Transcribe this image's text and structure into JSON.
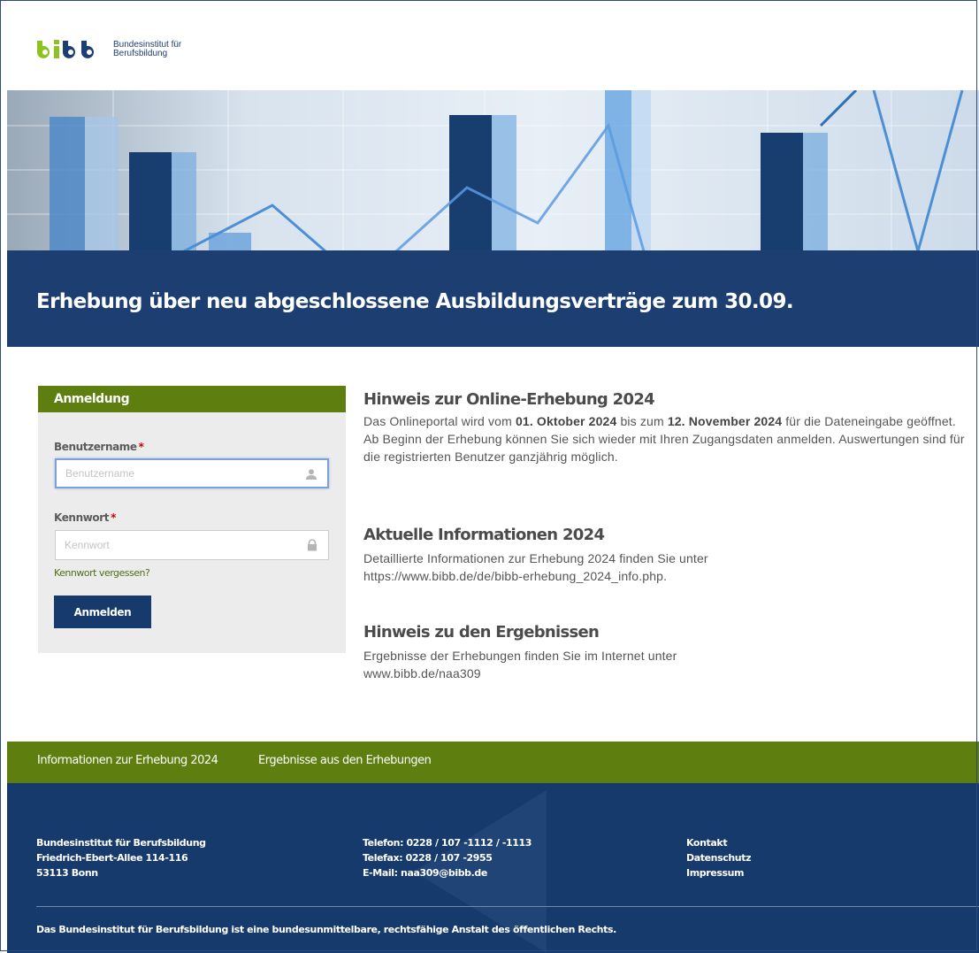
{
  "header": {
    "logo_text_line1": "Bundesinstitut für",
    "logo_text_line2": "Berufsbildung"
  },
  "banner": {
    "title": "Erhebung über neu abgeschlossene Ausbildungsverträge zum 30.09."
  },
  "login": {
    "heading": "Anmeldung",
    "username_label": "Benutzername",
    "username_placeholder": "Benutzername",
    "username_value": "",
    "password_label": "Kennwort",
    "password_placeholder": "Kennwort",
    "password_value": "",
    "required_mark": "*",
    "forgot_link": "Kennwort vergessen?",
    "submit_label": "Anmelden"
  },
  "info": {
    "section1": {
      "title": "Hinweis zur Online-Erhebung 2024",
      "text_pre": "Das Onlineportal wird vom ",
      "date_start": "01. Oktober 2024",
      "text_mid": " bis zum ",
      "date_end": "12. November 2024",
      "text_post": " für die Dateneingabe geöffnet. Ab Beginn der Erhebung können Sie sich wieder mit Ihren Zugangsdaten anmelden. Auswertungen sind für die registrierten Benutzer ganzjährig möglich."
    },
    "section2": {
      "title": "Aktuelle Informationen 2024",
      "text": "Detaillierte Informationen zur Erhebung 2024 finden Sie unter",
      "link": "https://www.bibb.de/de/bibb-erhebung_2024_info.php."
    },
    "section3": {
      "title": "Hinweis zu den Ergebnissen",
      "text": "Ergebnisse der Erhebungen finden Sie im Internet unter",
      "link": "www.bibb.de/naa309"
    }
  },
  "nav": {
    "link1": "Informationen zur Erhebung 2024",
    "link2": "Ergebnisse aus den Erhebungen"
  },
  "footer": {
    "address": [
      "Bundesinstitut für Berufsbildung",
      "Friedrich-Ebert-Allee 114-116",
      "53113 Bonn"
    ],
    "contact": [
      "Telefon: 0228 / 107 -1112 / -1113",
      "Telefax: 0228 / 107 -2955",
      "E-Mail: naa309@bibb.de"
    ],
    "links": [
      "Kontakt",
      "Datenschutz",
      "Impressum"
    ],
    "legal": "Das Bundesinstitut für Berufsbildung ist eine bundesunmittelbare, rechtsfähige Anstalt des öffentlichen Rechts."
  },
  "colors": {
    "brand_green": "#5e7f0f",
    "brand_navy": "#163a6b",
    "logo_green": "#8dc21f"
  },
  "icons": {
    "username_field": "user-icon",
    "password_field": "lock-icon"
  }
}
